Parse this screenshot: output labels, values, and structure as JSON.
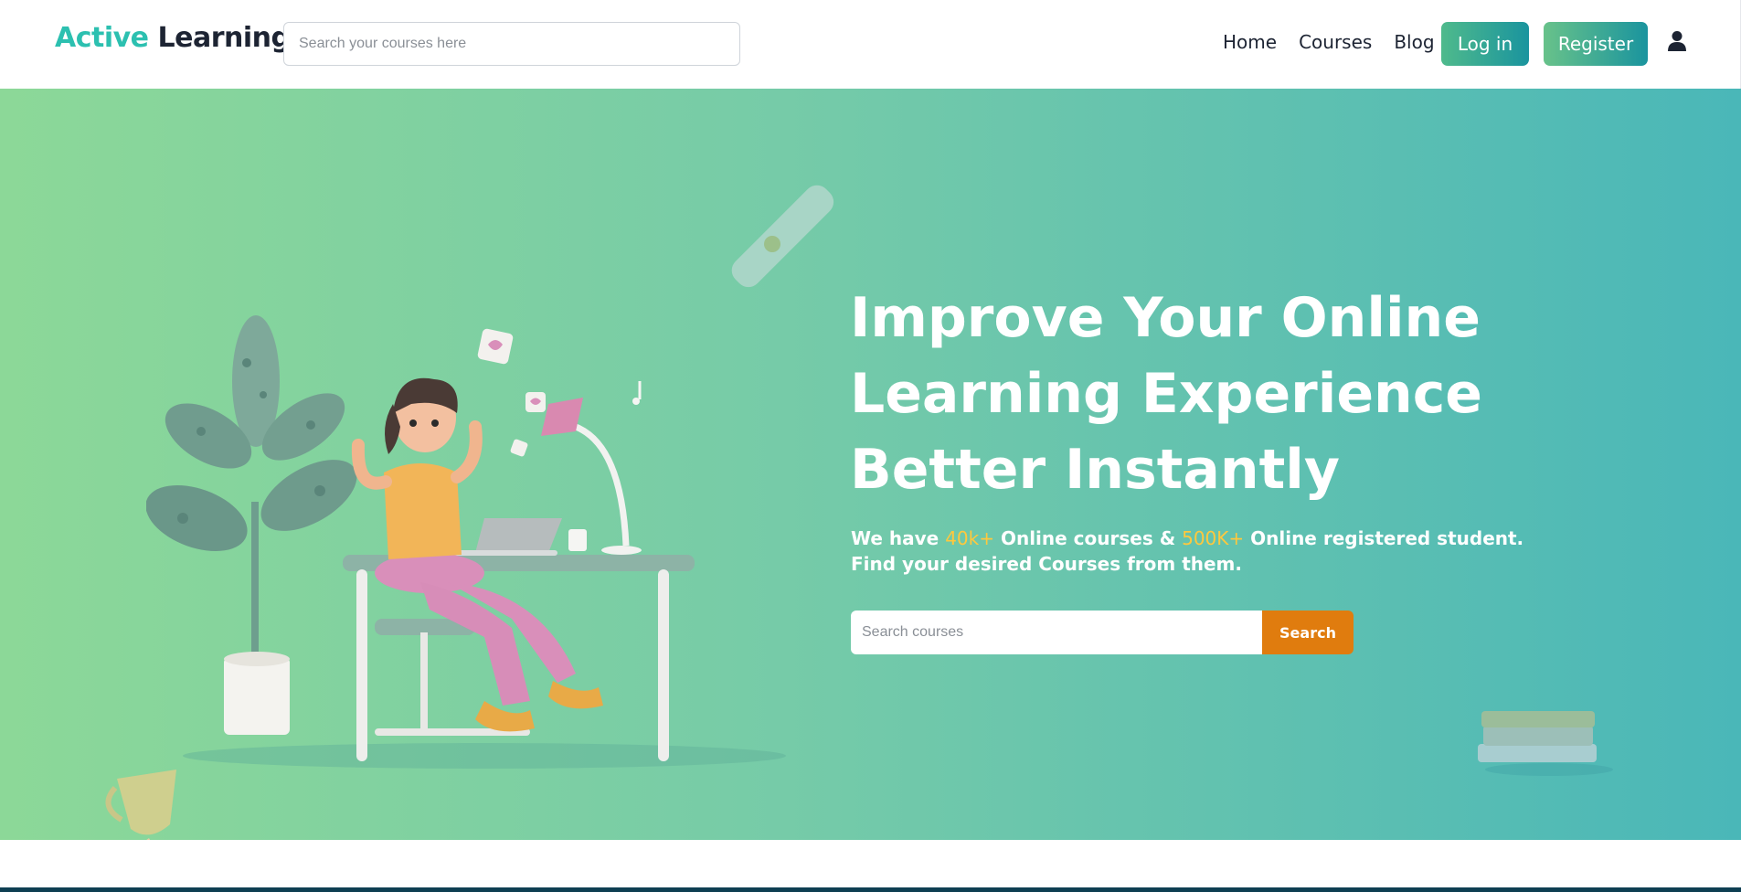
{
  "header": {
    "brand_part1": "Active",
    "brand_part2": "Learning",
    "search_placeholder": "Search your courses here",
    "nav": [
      {
        "label": "Home"
      },
      {
        "label": "Courses"
      },
      {
        "label": "Blog"
      }
    ],
    "login_label": "Log in",
    "register_label": "Register",
    "user_icon": "user-icon"
  },
  "hero": {
    "title_line1": "Improve Your Online",
    "title_line2": "Learning Experience",
    "title_line3": "Better Instantly",
    "sub_part1": "We have ",
    "sub_hl1": "40k+",
    "sub_part2": " Online courses & ",
    "sub_hl2": "500K+",
    "sub_part3": " Online registered student. Find your desired Courses from them.",
    "search_placeholder": "Search courses",
    "search_button": "Search"
  },
  "colors": {
    "brand_accent": "#2cc0b0",
    "highlight": "#ffc83d",
    "search_button": "#e07c0e",
    "hero_gradient_start": "#8cd898",
    "hero_gradient_end": "#4ab7b8"
  }
}
